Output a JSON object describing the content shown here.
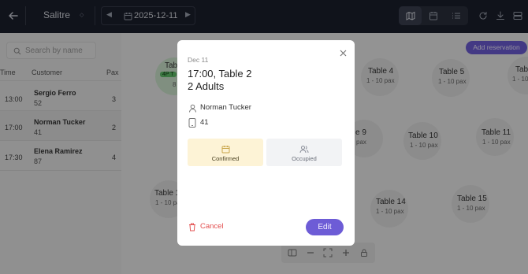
{
  "header": {
    "venue": "Salitre",
    "date": "2025-12-11",
    "views": [
      "map-icon",
      "calendar-icon",
      "list-icon"
    ]
  },
  "sidebar": {
    "search_placeholder": "Search by name",
    "columns": {
      "time": "Time",
      "customer": "Customer",
      "pax": "Pax"
    },
    "rows": [
      {
        "time": "13:00",
        "name": "Sergio Ferro",
        "sub": "52",
        "pax": "3"
      },
      {
        "time": "17:00",
        "name": "Norman Tucker",
        "sub": "41",
        "pax": "2"
      },
      {
        "time": "17:30",
        "name": "Elena Ramirez",
        "sub": "87",
        "pax": "4"
      }
    ]
  },
  "floor": {
    "add_reservation": "Add reservation",
    "tables": [
      {
        "name": "Tabl",
        "pax": "8"
      },
      {
        "name": "Table 4",
        "pax": "1 - 10 pax"
      },
      {
        "name": "Table 5",
        "pax": "1 - 10 pax"
      },
      {
        "name": "Tab",
        "pax": "1 - 10 pax"
      },
      {
        "name": "e 9",
        "pax": "pax"
      },
      {
        "name": "Table 10",
        "pax": "1 - 10 pax"
      },
      {
        "name": "Table 11",
        "pax": "1 - 10 pax"
      },
      {
        "name": "Table 1",
        "pax": "1 - 10 pax"
      },
      {
        "name": "Table 14",
        "pax": "1 - 10 pax"
      },
      {
        "name": "Table 15",
        "pax": "1 - 10 pax"
      }
    ],
    "badge": "4P T"
  },
  "modal": {
    "date": "Dec 11",
    "title": "17:00, Table 2",
    "subtitle": "2 Adults",
    "guest_name": "Norman Tucker",
    "guest_phone": "41",
    "status_confirmed": "Confirmed",
    "status_occupied": "Occupied",
    "cancel_label": "Cancel",
    "edit_label": "Edit"
  },
  "colors": {
    "topbar": "#1b1f2c",
    "accent": "#6d5cd6",
    "confirmed_bg": "#fdf3d6",
    "cancel": "#e35050"
  }
}
